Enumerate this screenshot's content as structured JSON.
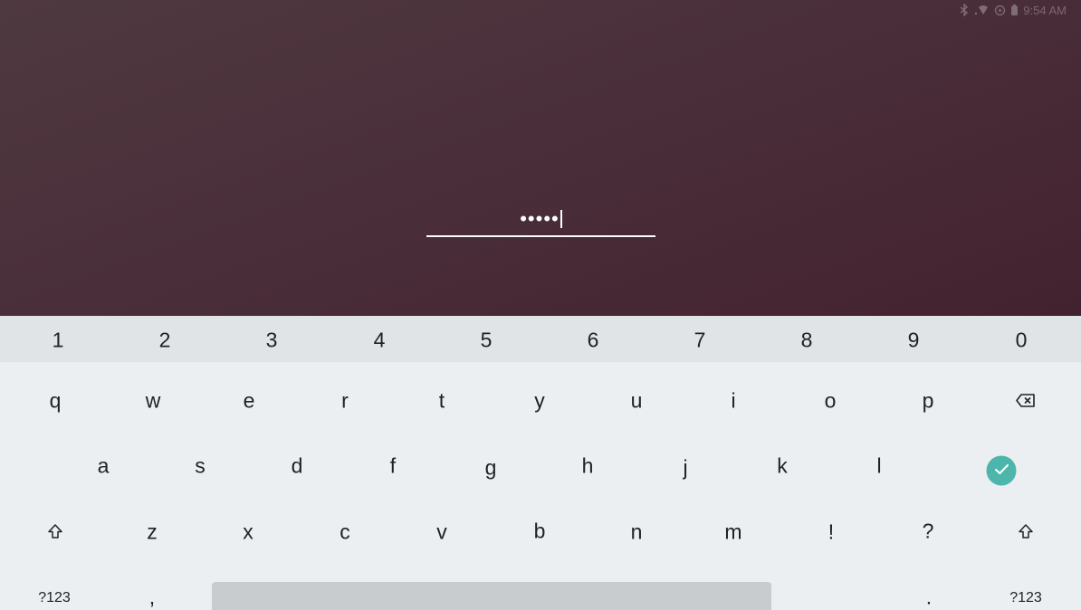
{
  "status_bar": {
    "time": "9:54 AM",
    "icons": [
      "bluetooth-icon",
      "wifi-icon",
      "data-saver-icon",
      "battery-icon"
    ]
  },
  "pin_field": {
    "masked_value": "•••••"
  },
  "keyboard": {
    "number_row": [
      "1",
      "2",
      "3",
      "4",
      "5",
      "6",
      "7",
      "8",
      "9",
      "0"
    ],
    "row1": [
      "q",
      "w",
      "e",
      "r",
      "t",
      "y",
      "u",
      "i",
      "o",
      "p"
    ],
    "row2": [
      "a",
      "s",
      "d",
      "f",
      "g",
      "h",
      "j",
      "k",
      "l"
    ],
    "row3": [
      "z",
      "x",
      "c",
      "v",
      "b",
      "n",
      "m",
      "!",
      "?"
    ],
    "bottom_left_symbols": "?123",
    "comma": ",",
    "period": ".",
    "bottom_right_symbols": "?123",
    "icons": {
      "backspace": "backspace-icon",
      "enter": "checkmark-icon",
      "shift_left": "shift-icon",
      "shift_right": "shift-icon"
    },
    "colors": {
      "enter_accent": "#4db6ac",
      "number_row_bg": "#e1e4e7",
      "keyboard_bg": "#eceff1",
      "spacebar": "#c8cccf"
    }
  }
}
